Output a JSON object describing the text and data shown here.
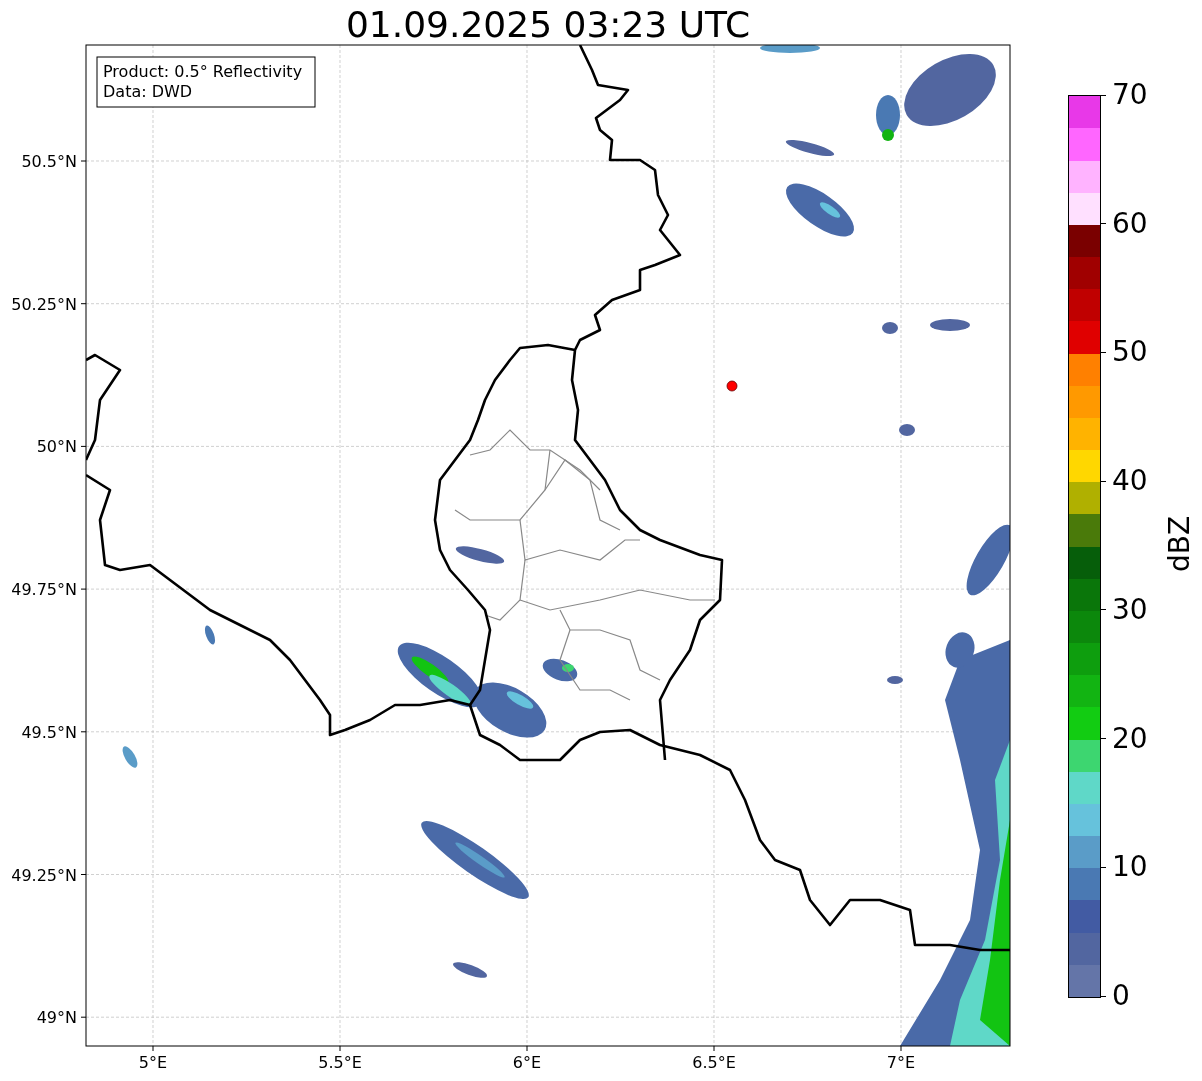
{
  "title": "01.09.2025 03:23 UTC",
  "legend": {
    "lines": [
      "Product: 0.5° Reflectivity",
      "Data: DWD"
    ]
  },
  "map": {
    "y_ticks": [
      "50.5°N",
      "50.25°N",
      "50°N",
      "49.75°N",
      "49.5°N",
      "49.25°N",
      "49°N"
    ],
    "x_ticks": [
      "5°E",
      "5.5°E",
      "6°E",
      "6.5°E",
      "7°E"
    ],
    "marker": {
      "color": "#ff0000"
    }
  },
  "colorbar": {
    "label": "dBZ",
    "ticks": [
      "70",
      "60",
      "50",
      "40",
      "30",
      "20",
      "10",
      "0"
    ],
    "bands": [
      {
        "color": "#6475a8"
      },
      {
        "color": "#5266a0"
      },
      {
        "color": "#425ba3"
      },
      {
        "color": "#4a79b3"
      },
      {
        "color": "#5a9cc8"
      },
      {
        "color": "#66c2dc"
      },
      {
        "color": "#5fd8c8"
      },
      {
        "color": "#3dd670"
      },
      {
        "color": "#12cc12"
      },
      {
        "color": "#12b412"
      },
      {
        "color": "#0e9e0e"
      },
      {
        "color": "#0c880c"
      },
      {
        "color": "#0a760a"
      },
      {
        "color": "#065e0a"
      },
      {
        "color": "#4a7a0a"
      },
      {
        "color": "#b0b000"
      },
      {
        "color": "#ffd700"
      },
      {
        "color": "#ffb300"
      },
      {
        "color": "#ff9900"
      },
      {
        "color": "#ff8000"
      },
      {
        "color": "#e00000"
      },
      {
        "color": "#c00000"
      },
      {
        "color": "#a00000"
      },
      {
        "color": "#7a0000"
      },
      {
        "color": "#ffe0ff"
      },
      {
        "color": "#ffb3ff"
      },
      {
        "color": "#ff66ff"
      },
      {
        "color": "#e838e8"
      }
    ]
  }
}
